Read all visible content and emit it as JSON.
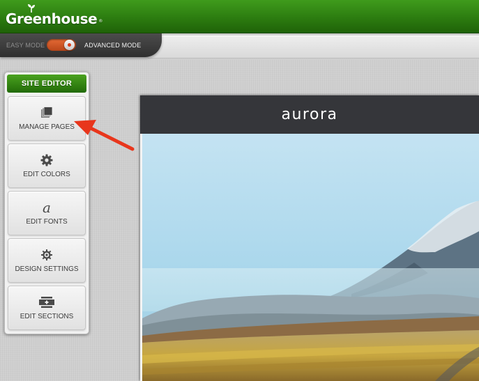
{
  "app": {
    "brand": "Greenhouse",
    "brand_mark": "®"
  },
  "mode_bar": {
    "easy_label": "EASY MODE",
    "advanced_label": "ADVANCED MODE",
    "advanced_enabled": true
  },
  "site_editor": {
    "title": "SITE EDITOR",
    "items": [
      {
        "label": "MANAGE PAGES",
        "icon": "pages-stack-icon"
      },
      {
        "label": "EDIT COLORS",
        "icon": "gear-icon"
      },
      {
        "label": "EDIT FONTS",
        "icon": "font-a-icon",
        "glyph": "a"
      },
      {
        "label": "DESIGN SETTINGS",
        "icon": "settings-cog-icon"
      },
      {
        "label": "EDIT SECTIONS",
        "icon": "sections-add-icon"
      }
    ]
  },
  "preview": {
    "site_logo": "aurora"
  },
  "colors": {
    "brand_green": "#2c7c10",
    "toggle_orange": "#e56a35",
    "annotation_red": "#e8361c",
    "preview_header": "#35363a"
  }
}
